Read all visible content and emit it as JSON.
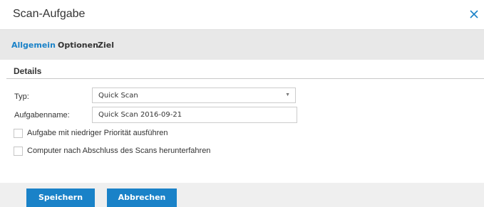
{
  "dialog": {
    "title": "Scan-Aufgabe",
    "close_icon": "close-icon",
    "accent_color": "#1a82c8"
  },
  "tabs": [
    {
      "label": "Allgemein",
      "active": true
    },
    {
      "label": "Optionen",
      "active": false
    },
    {
      "label": "Ziel",
      "active": false
    }
  ],
  "section": {
    "title": "Details"
  },
  "form": {
    "type_label": "Typ:",
    "type_value": "Quick Scan",
    "name_label": "Aufgabenname:",
    "name_value": "Quick Scan 2016-09-21",
    "low_priority_label": "Aufgabe mit niedriger Priorität ausführen",
    "low_priority_checked": false,
    "shutdown_label": "Computer nach Abschluss des Scans herunterfahren",
    "shutdown_checked": false
  },
  "buttons": {
    "save_label": "Speichern",
    "cancel_label": "Abbrechen"
  }
}
